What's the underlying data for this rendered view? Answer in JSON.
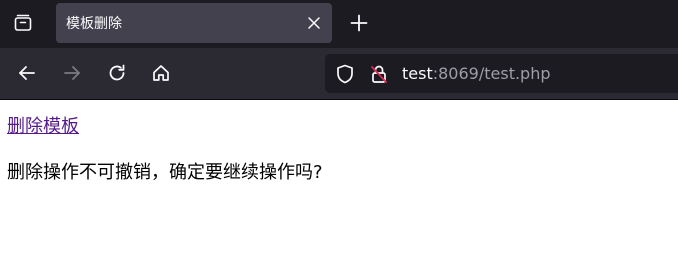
{
  "browser": {
    "tab": {
      "title": "模板删除"
    },
    "address_bar": {
      "host": "test",
      "rest": ":8069/test.php"
    },
    "colors": {
      "tabbar_bg": "#1c1b22",
      "active_tab_bg": "#42414d",
      "toolbar_bg": "#2b2a33",
      "urlbar_bg": "#1c1b22",
      "icon": "#fbfbfe",
      "icon_disabled": "#7a7a82",
      "insecure_slash": "#e22850"
    },
    "icons": {
      "tabs_list": "tab-list-icon",
      "tab_close": "close-icon",
      "new_tab": "plus-icon",
      "back": "back-arrow-icon",
      "forward": "forward-arrow-icon",
      "reload": "reload-icon",
      "home": "home-icon",
      "tracking_protection": "shield-icon",
      "connection": "insecure-lock-icon"
    },
    "forward_enabled": false
  },
  "page": {
    "link_text": "删除模板",
    "message": "删除操作不可撤销，确定要继续操作吗?",
    "link_color": "#551a8b"
  }
}
